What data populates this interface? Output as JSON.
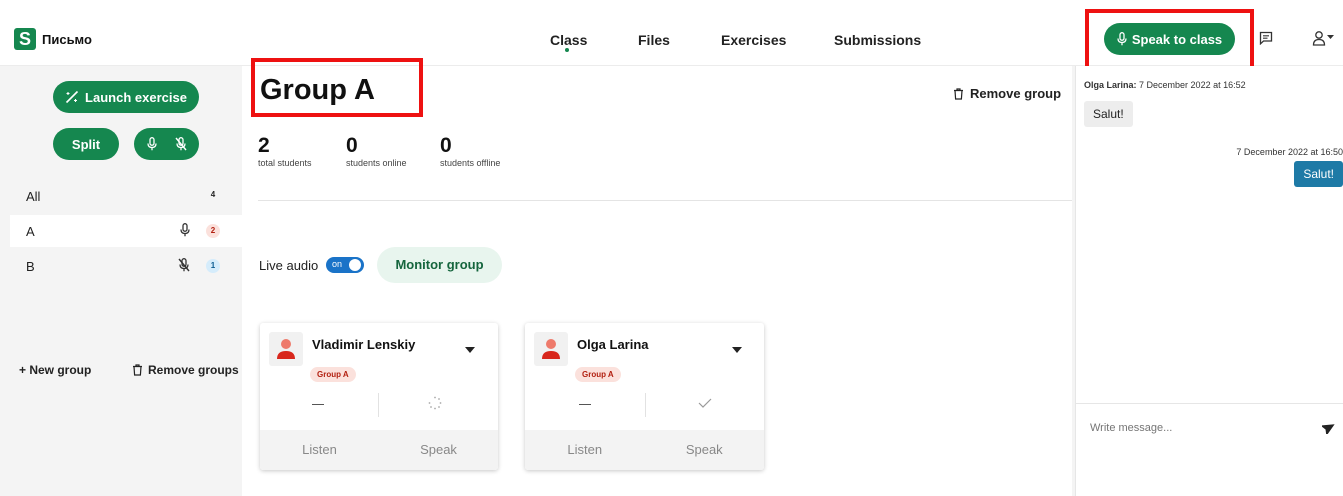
{
  "app": {
    "logo_letter": "S",
    "brand_name": "Письмо"
  },
  "nav": {
    "items": [
      "Class",
      "Files",
      "Exercises",
      "Submissions"
    ],
    "active": "Class"
  },
  "header": {
    "speak_to_class": "Speak to class"
  },
  "sidebar": {
    "launch_exercise": "Launch exercise",
    "split": "Split",
    "groups": [
      {
        "label": "All",
        "count": "4"
      },
      {
        "label": "A",
        "count": "2",
        "mic": "on"
      },
      {
        "label": "B",
        "count": "1",
        "mic": "off"
      }
    ],
    "new_group": "+ New group",
    "remove_groups": "Remove groups"
  },
  "main": {
    "group_title": "Group A",
    "remove_group": "Remove group",
    "stats": [
      {
        "value": "2",
        "label": "total students"
      },
      {
        "value": "0",
        "label": "students online"
      },
      {
        "value": "0",
        "label": "students offline"
      }
    ],
    "live_audio_label": "Live audio",
    "live_audio_toggle": "on",
    "monitor_group": "Monitor group",
    "students": [
      {
        "name": "Vladimir Lenskiy",
        "group": "Group A",
        "status": "loading",
        "listen": "Listen",
        "speak": "Speak"
      },
      {
        "name": "Olga Larina",
        "group": "Group A",
        "status": "check",
        "listen": "Listen",
        "speak": "Speak"
      }
    ]
  },
  "chat": {
    "messages": [
      {
        "sender": "Olga Larina:",
        "time": "7 December 2022 at 16:52",
        "text": "Salut!",
        "side": "left"
      },
      {
        "time": "7 December 2022 at 16:50",
        "text": "Salut!",
        "side": "right"
      }
    ],
    "input_placeholder": "Write message..."
  },
  "colors": {
    "accent_green": "#15874f",
    "highlight_red": "#ee1111",
    "chat_bubble_blue": "#1e7aa6",
    "toggle_blue": "#1a73c8"
  }
}
